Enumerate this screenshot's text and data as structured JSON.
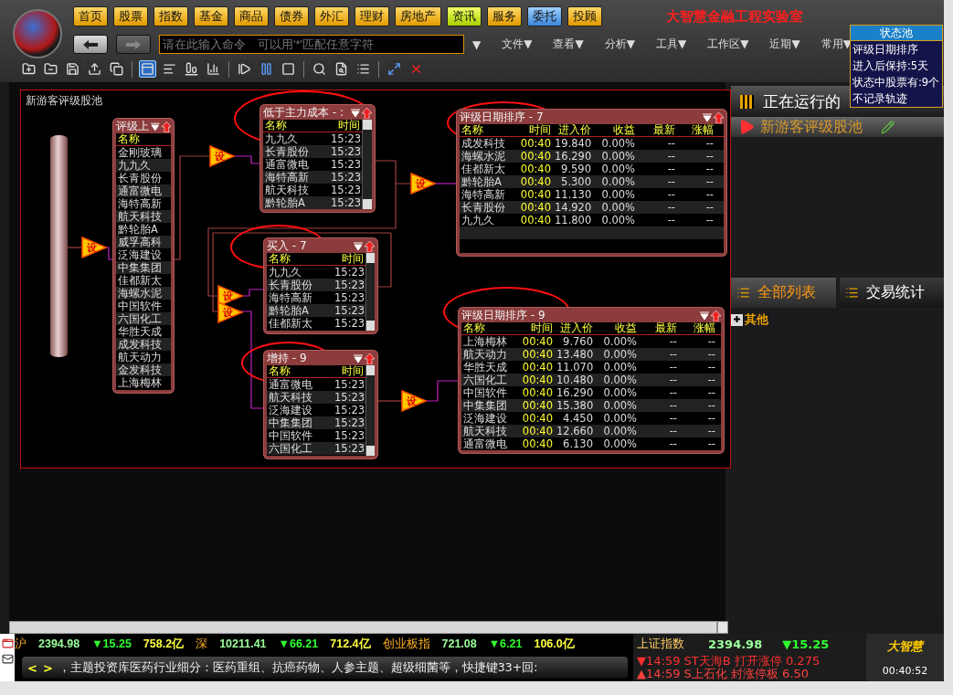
{
  "app_title": "大智慧金融工程实验室",
  "nav": [
    {
      "label": "首页",
      "kind": "plain",
      "selected": false
    },
    {
      "label": "股票",
      "kind": "plain",
      "selected": false
    },
    {
      "label": "指数",
      "kind": "plain",
      "selected": false
    },
    {
      "label": "基金",
      "kind": "plain",
      "selected": false
    },
    {
      "label": "商品",
      "kind": "plain",
      "selected": false
    },
    {
      "label": "债券",
      "kind": "plain",
      "selected": false
    },
    {
      "label": "外汇",
      "kind": "plain",
      "selected": false
    },
    {
      "label": "理财",
      "kind": "plain",
      "selected": false
    },
    {
      "label": "房地产",
      "kind": "plain",
      "selected": false
    },
    {
      "label": "资讯",
      "kind": "news",
      "selected": false
    },
    {
      "label": "服务",
      "kind": "plain",
      "selected": false
    },
    {
      "label": "委托",
      "kind": "plain",
      "selected": true
    },
    {
      "label": "投顾",
      "kind": "plain",
      "selected": false
    }
  ],
  "command": {
    "placeholder": "请在此输入命令　可以用'*'匹配任意字符",
    "dropdown": "▼"
  },
  "menus": [
    "文件▼",
    "查看▼",
    "分析▼",
    "工具▼",
    "工作区▼",
    "近期▼",
    "常用▼"
  ],
  "toolbar": [
    {
      "kind": "folder-add",
      "selected": false
    },
    {
      "kind": "folder-remove",
      "selected": false
    },
    {
      "kind": "save",
      "selected": false
    },
    {
      "kind": "export",
      "selected": false
    },
    {
      "kind": "copy",
      "selected": false
    },
    {
      "kind": "layout-top",
      "selected": true
    },
    {
      "kind": "align-left",
      "selected": false
    },
    {
      "kind": "align-bottom",
      "selected": false
    },
    {
      "kind": "bars",
      "selected": false
    },
    {
      "kind": "step",
      "selected": false
    },
    {
      "kind": "pause",
      "selected": false
    },
    {
      "kind": "stop",
      "selected": false
    },
    {
      "kind": "search",
      "selected": false
    },
    {
      "kind": "search-doc",
      "selected": false
    },
    {
      "kind": "list",
      "selected": false
    },
    {
      "kind": "expand",
      "selected": false
    },
    {
      "kind": "close",
      "selected": false
    }
  ],
  "canvas": {
    "title": "新游客评级股池",
    "source": {
      "title": "评级上",
      "column": "名称",
      "items": [
        "金刚玻璃",
        "九九久",
        "长青股份",
        "通富微电",
        "海特高新",
        "航天科技",
        "黔轮胎A",
        "威孚高科",
        "泛海建设",
        "中集集团",
        "佳都新太",
        "海螺水泥",
        "中国软件",
        "六国化工",
        "华胜天成",
        "成发科技",
        "航天动力",
        "金发科技",
        "上海梅林"
      ]
    },
    "filters": [
      {
        "label": "设"
      },
      {
        "label": "设"
      },
      {
        "label": "设"
      },
      {
        "label": "设"
      },
      {
        "label": "设"
      },
      {
        "label": "设"
      }
    ],
    "nodes": [
      {
        "kind": "small",
        "title": "低于主力成本 - :",
        "columns": [
          "名称",
          "时间"
        ],
        "rows": [
          [
            "九九久",
            "15:23"
          ],
          [
            "长青股份",
            "15:23"
          ],
          [
            "通富微电",
            "15:23"
          ],
          [
            "海特高新",
            "15:23"
          ],
          [
            "航天科技",
            "15:23"
          ],
          [
            "黔轮胎A",
            "15:23"
          ]
        ]
      },
      {
        "kind": "small",
        "title": "买入 - 7",
        "columns": [
          "名称",
          "时间"
        ],
        "rows": [
          [
            "九九久",
            "15:23"
          ],
          [
            "长青股份",
            "15:23"
          ],
          [
            "海特高新",
            "15:23"
          ],
          [
            "黔轮胎A",
            "15:23"
          ],
          [
            "佳都新太",
            "15:23"
          ]
        ]
      },
      {
        "kind": "small",
        "title": "增持 - 9",
        "columns": [
          "名称",
          "时间"
        ],
        "rows": [
          [
            "通富微电",
            "15:23"
          ],
          [
            "航天科技",
            "15:23"
          ],
          [
            "泛海建设",
            "15:23"
          ],
          [
            "中集集团",
            "15:23"
          ],
          [
            "中国软件",
            "15:23"
          ],
          [
            "六国化工",
            "15:23"
          ]
        ]
      },
      {
        "kind": "wide",
        "title": "评级日期排序 - 7",
        "columns": [
          "名称",
          "时间",
          "进入价",
          "收益",
          "最新",
          "涨幅"
        ],
        "rows": [
          [
            "成发科技",
            "00:40",
            "19.840",
            "0.00%",
            "--",
            "--"
          ],
          [
            "海螺水泥",
            "00:40",
            "16.290",
            "0.00%",
            "--",
            "--"
          ],
          [
            "佳都新太",
            "00:40",
            "9.590",
            "0.00%",
            "--",
            "--"
          ],
          [
            "黔轮胎A",
            "00:40",
            "5.300",
            "0.00%",
            "--",
            "--"
          ],
          [
            "海特高新",
            "00:40",
            "11.130",
            "0.00%",
            "--",
            "--"
          ],
          [
            "长青股份",
            "00:40",
            "14.920",
            "0.00%",
            "--",
            "--"
          ],
          [
            "九九久",
            "00:40",
            "11.800",
            "0.00%",
            "--",
            "--"
          ]
        ]
      },
      {
        "kind": "wide",
        "title": "评级日期排序 - 9",
        "columns": [
          "名称",
          "时间",
          "进入价",
          "收益",
          "最新",
          "涨幅"
        ],
        "rows": [
          [
            "上海梅林",
            "00:40",
            "9.760",
            "0.00%",
            "--",
            "--"
          ],
          [
            "航天动力",
            "00:40",
            "13.480",
            "0.00%",
            "--",
            "--"
          ],
          [
            "华胜天成",
            "00:40",
            "11.070",
            "0.00%",
            "--",
            "--"
          ],
          [
            "六国化工",
            "00:40",
            "10.480",
            "0.00%",
            "--",
            "--"
          ],
          [
            "中国软件",
            "00:40",
            "16.290",
            "0.00%",
            "--",
            "--"
          ],
          [
            "中集集团",
            "00:40",
            "15.380",
            "0.00%",
            "--",
            "--"
          ],
          [
            "泛海建设",
            "00:40",
            "4.450",
            "0.00%",
            "--",
            "--"
          ],
          [
            "航天科技",
            "00:40",
            "12.660",
            "0.00%",
            "--",
            "--"
          ],
          [
            "通富微电",
            "00:40",
            "6.130",
            "0.00%",
            "--",
            "--"
          ]
        ]
      }
    ]
  },
  "sidebar": {
    "header": "正在运行的",
    "strategy": "新游客评级股池",
    "tabs": [
      {
        "label": "全部列表",
        "selected": true
      },
      {
        "label": "交易统计",
        "selected": false
      }
    ],
    "tree": [
      {
        "label": "其他",
        "expanded": false
      }
    ]
  },
  "tooltip": {
    "title": "状态池",
    "lines": [
      "评级日期排序",
      "进入后保持:5天",
      "状态中股票有:9个",
      "不记录轨迹"
    ]
  },
  "ticker": {
    "quotes": [
      {
        "kind": "label",
        "text": "沪"
      },
      {
        "kind": "price",
        "text": "2394.98"
      },
      {
        "kind": "change",
        "text": "▼15.25"
      },
      {
        "kind": "amount",
        "text": "758.2亿"
      },
      {
        "kind": "label",
        "text": "深"
      },
      {
        "kind": "price",
        "text": "10211.41"
      },
      {
        "kind": "change",
        "text": "▼66.21"
      },
      {
        "kind": "amount",
        "text": "712.4亿"
      },
      {
        "kind": "label",
        "text": "创业板指"
      },
      {
        "kind": "price",
        "text": "721.08"
      },
      {
        "kind": "change",
        "text": "▼6.21"
      },
      {
        "kind": "amount",
        "text": "106.0亿"
      }
    ],
    "prev": "<",
    "next": ">",
    "message": "，主题投资库医药行业细分：医药重组、抗癌药物、人参主题、超级细菌等，快捷键33+回:",
    "index": {
      "name": "上证指数",
      "price": "2394.98",
      "change": "▼15.25"
    },
    "alerts": [
      {
        "kind": "down",
        "text": "▼14:59 ST天海B 打开涨停 0.275"
      },
      {
        "kind": "up",
        "text": "▲14:59 S上石化 封涨停板 6.50"
      }
    ],
    "brand": "大智慧",
    "time": "00:40:52"
  }
}
